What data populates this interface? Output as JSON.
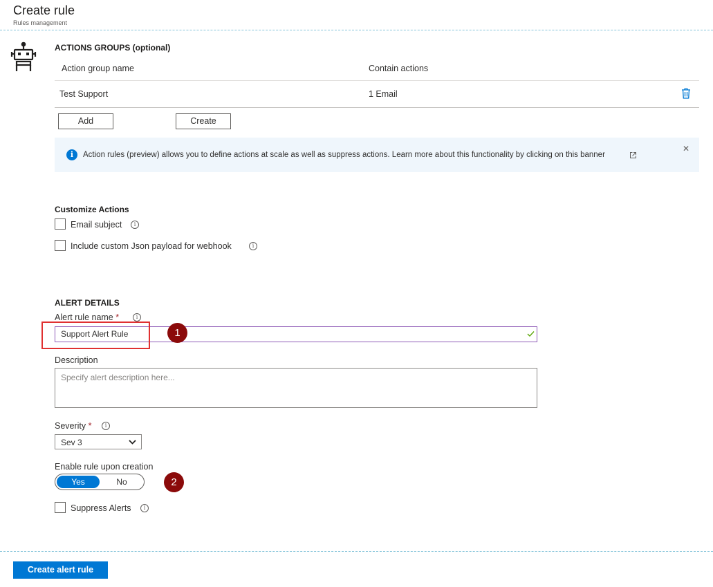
{
  "header": {
    "title": "Create rule",
    "subtitle": "Rules management"
  },
  "action_groups": {
    "heading": "ACTIONS GROUPS (optional)",
    "columns": [
      "Action group name",
      "Contain actions"
    ],
    "rows": [
      {
        "name": "Test Support",
        "actions": "1 Email"
      }
    ],
    "add_label": "Add",
    "create_label": "Create"
  },
  "banner": {
    "text": "Action rules (preview) allows you to define actions at scale as well as suppress actions. Learn more about this functionality by clicking on this banner",
    "info_glyph": "i",
    "close_glyph": "✕"
  },
  "customize": {
    "heading": "Customize Actions",
    "email_subject": "Email subject",
    "custom_json": "Include custom Json payload for webhook"
  },
  "alert_details": {
    "heading": "ALERT DETAILS",
    "rule_name_label": "Alert rule name",
    "required_mark": "*",
    "rule_name_value": "Support Alert Rule",
    "description_label": "Description",
    "description_placeholder": "Specify alert description here...",
    "severity_label": "Severity",
    "severity_value": "Sev 3",
    "enable_label": "Enable rule upon creation",
    "toggle_yes": "Yes",
    "toggle_no": "No",
    "suppress_label": "Suppress Alerts"
  },
  "annotations": {
    "badge1": "1",
    "badge2": "2"
  },
  "footer": {
    "create_alert_rule": "Create alert rule"
  },
  "colors": {
    "accent": "#0078d4",
    "annotation": "#8b0a0a",
    "highlight": "#e03131"
  }
}
